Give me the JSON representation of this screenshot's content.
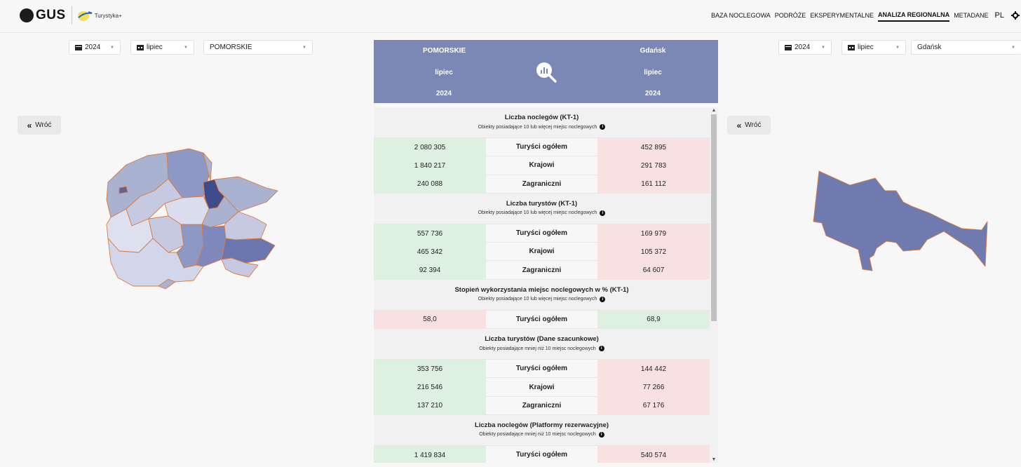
{
  "brand": {
    "logo_text": "GUS",
    "sub_logo": "Turystyka+"
  },
  "nav": {
    "items": [
      "BAZA NOCLEGOWA",
      "PODRÓŻE",
      "EKSPERYMENTALNE",
      "ANALIZA REGIONALNA",
      "METADANE"
    ],
    "active": "ANALIZA REGIONALNA",
    "lang": "PL"
  },
  "left": {
    "year": "2024",
    "month": "lipiec",
    "region": "POMORSKIE",
    "back": "Wróć"
  },
  "right": {
    "year": "2024",
    "month": "lipiec",
    "region": "Gdańsk",
    "back": "Wróć"
  },
  "header": {
    "left": {
      "region": "POMORSKIE",
      "month": "lipiec",
      "year": "2024"
    },
    "right": {
      "region": "Gdańsk",
      "month": "lipiec",
      "year": "2024"
    }
  },
  "colors": {
    "header_bg": "#7b87b5",
    "higher": "#def0df",
    "lower": "#fae1e1",
    "map_fill": "#6f7aaf",
    "map_border": "#e07a3a"
  },
  "sections": [
    {
      "title": "Liczba noclegów (KT-1)",
      "subtitle": "Obiekty posiadające 10 lub więcej miejsc noclegowych",
      "rows": [
        {
          "label": "Turyści ogółem",
          "left": "2 080 305",
          "right": "452 895",
          "leftColor": "g",
          "rightColor": "r"
        },
        {
          "label": "Krajowi",
          "left": "1 840 217",
          "right": "291 783",
          "leftColor": "g",
          "rightColor": "r"
        },
        {
          "label": "Zagraniczni",
          "left": "240 088",
          "right": "161 112",
          "leftColor": "g",
          "rightColor": "r"
        }
      ]
    },
    {
      "title": "Liczba turystów (KT-1)",
      "subtitle": "Obiekty posiadające 10 lub więcej miejsc noclegowych",
      "rows": [
        {
          "label": "Turyści ogółem",
          "left": "557 736",
          "right": "169 979",
          "leftColor": "g",
          "rightColor": "r"
        },
        {
          "label": "Krajowi",
          "left": "465 342",
          "right": "105 372",
          "leftColor": "g",
          "rightColor": "r"
        },
        {
          "label": "Zagraniczni",
          "left": "92 394",
          "right": "64 607",
          "leftColor": "g",
          "rightColor": "r"
        }
      ]
    },
    {
      "title": "Stopień wykorzystania miejsc noclegowych w % (KT-1)",
      "subtitle": "Obiekty posiadające 10 lub więcej miejsc noclegowych",
      "rows": [
        {
          "label": "Turyści ogółem",
          "left": "58,0",
          "right": "68,9",
          "leftColor": "r",
          "rightColor": "g"
        }
      ]
    },
    {
      "title": "Liczba turystów (Dane szacunkowe)",
      "subtitle": "Obiekty posiadające mniej niż 10 miejsc noclegowych",
      "rows": [
        {
          "label": "Turyści ogółem",
          "left": "353 756",
          "right": "144 442",
          "leftColor": "g",
          "rightColor": "r"
        },
        {
          "label": "Krajowi",
          "left": "216 546",
          "right": "77 266",
          "leftColor": "g",
          "rightColor": "r"
        },
        {
          "label": "Zagraniczni",
          "left": "137 210",
          "right": "67 176",
          "leftColor": "g",
          "rightColor": "r"
        }
      ]
    },
    {
      "title": "Liczba noclegów (Platformy rezerwacyjne)",
      "subtitle": "Obiekty posiadające mniej niż 10 miejsc noclegowych",
      "rows": [
        {
          "label": "Turyści ogółem",
          "left": "1 419 834",
          "right": "540 574",
          "leftColor": "g",
          "rightColor": "r"
        }
      ]
    }
  ]
}
